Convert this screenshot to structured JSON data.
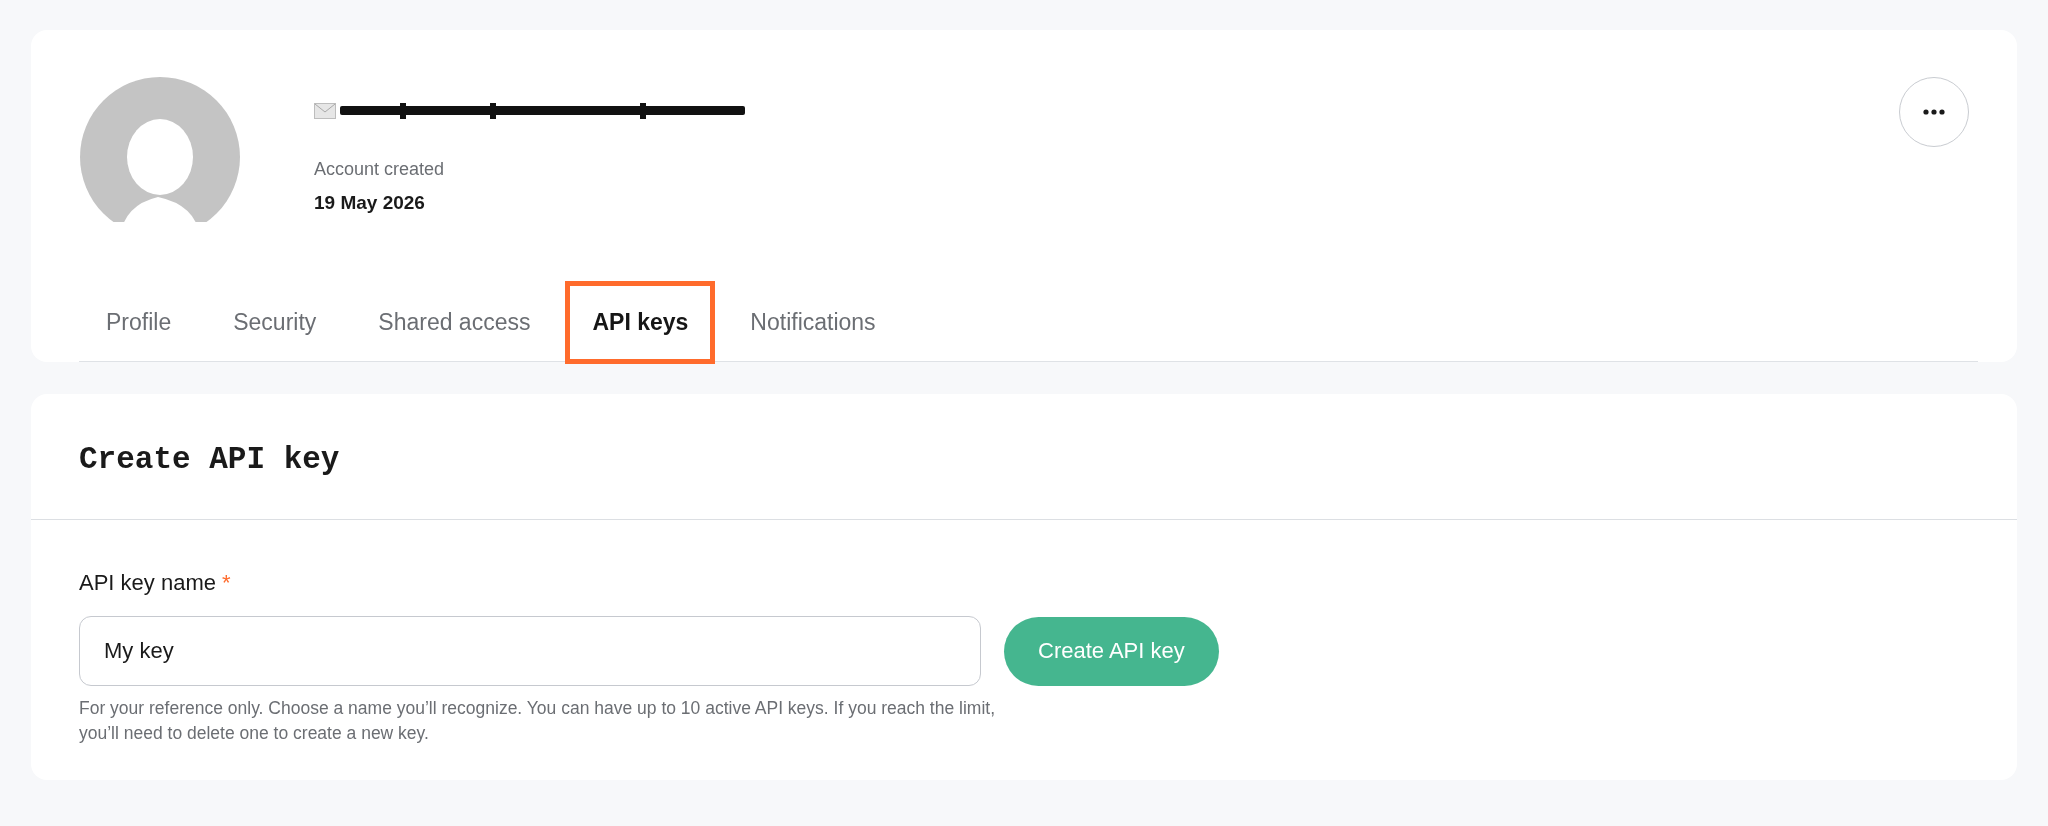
{
  "profile": {
    "account_created_label": "Account created",
    "account_created_date": "19 May 2026"
  },
  "tabs": [
    {
      "label": "Profile",
      "selected": false
    },
    {
      "label": "Security",
      "selected": false
    },
    {
      "label": "Shared access",
      "selected": false
    },
    {
      "label": "API keys",
      "selected": true
    },
    {
      "label": "Notifications",
      "selected": false
    }
  ],
  "create_key": {
    "title": "Create API key",
    "field_label": "API key name",
    "required_mark": "*",
    "value": "My key",
    "button": "Create API key",
    "help": "For your reference only. Choose a name you’ll recognize. You can have up to 10 active API keys. If you reach the limit, you’ll need to delete one to create a new key."
  }
}
